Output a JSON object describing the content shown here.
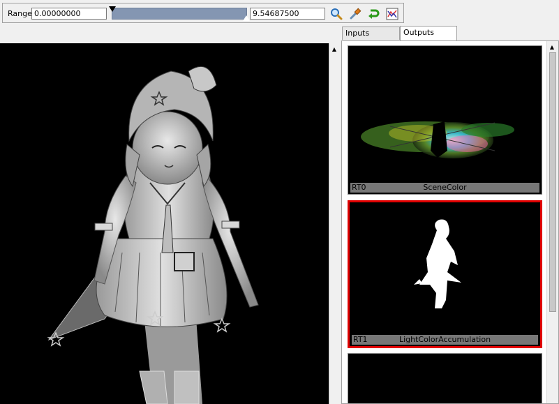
{
  "toolbar": {
    "range_label": "Range",
    "range_min": "0.00000000",
    "range_max": "9.54687500",
    "slider_color": "#8496b2"
  },
  "icons": {
    "zoom": "magnifier-icon",
    "picker": "eyedropper-icon",
    "reset": "undo-arrow-icon",
    "histogram": "histogram-icon"
  },
  "tabs": [
    {
      "label": "Inputs",
      "active": false
    },
    {
      "label": "Outputs",
      "active": true
    }
  ],
  "render_targets": [
    {
      "id": "RT0",
      "name": "SceneColor",
      "selected": false
    },
    {
      "id": "RT1",
      "name": "LightColorAccumulation",
      "selected": true
    },
    {
      "id": "",
      "name": "",
      "selected": false
    }
  ],
  "colors": {
    "selection": "#e00000",
    "viewport_bg": "#000000"
  }
}
